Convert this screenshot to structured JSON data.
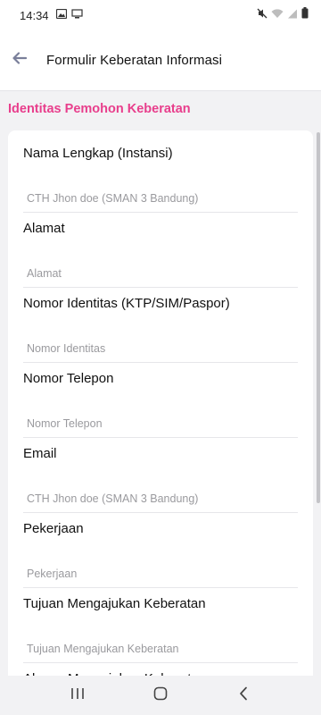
{
  "status_bar": {
    "time": "14:34",
    "icons_left": [
      "image-icon",
      "cast-icon"
    ],
    "icons_right": [
      "mute-icon",
      "wifi-icon",
      "signal-icon",
      "battery-icon"
    ]
  },
  "app_bar": {
    "title": "Formulir Keberatan Informasi",
    "back_icon": "arrow-left-icon"
  },
  "section": {
    "title": "Identitas Pemohon Keberatan"
  },
  "fields": [
    {
      "label": "Nama Lengkap (Instansi)",
      "placeholder": "CTH Jhon doe (SMAN 3 Bandung)",
      "value": ""
    },
    {
      "label": "Alamat",
      "placeholder": "Alamat",
      "value": ""
    },
    {
      "label": "Nomor Identitas (KTP/SIM/Paspor)",
      "placeholder": "Nomor Identitas",
      "value": ""
    },
    {
      "label": "Nomor Telepon",
      "placeholder": "Nomor Telepon",
      "value": ""
    },
    {
      "label": "Email",
      "placeholder": "CTH Jhon doe (SMAN 3 Bandung)",
      "value": ""
    },
    {
      "label": "Pekerjaan",
      "placeholder": "Pekerjaan",
      "value": ""
    },
    {
      "label": "Tujuan Mengajukan Keberatan",
      "placeholder": "Tujuan Mengajukan Keberatan",
      "value": ""
    },
    {
      "label": "Alasan Mengajukan Keberatan",
      "placeholder": "",
      "value": ""
    }
  ],
  "colors": {
    "accent": "#e83e8c",
    "back_icon": "#7a7f9a"
  },
  "nav_bar": {
    "buttons": [
      "recent-apps-icon",
      "home-icon",
      "back-icon"
    ]
  }
}
